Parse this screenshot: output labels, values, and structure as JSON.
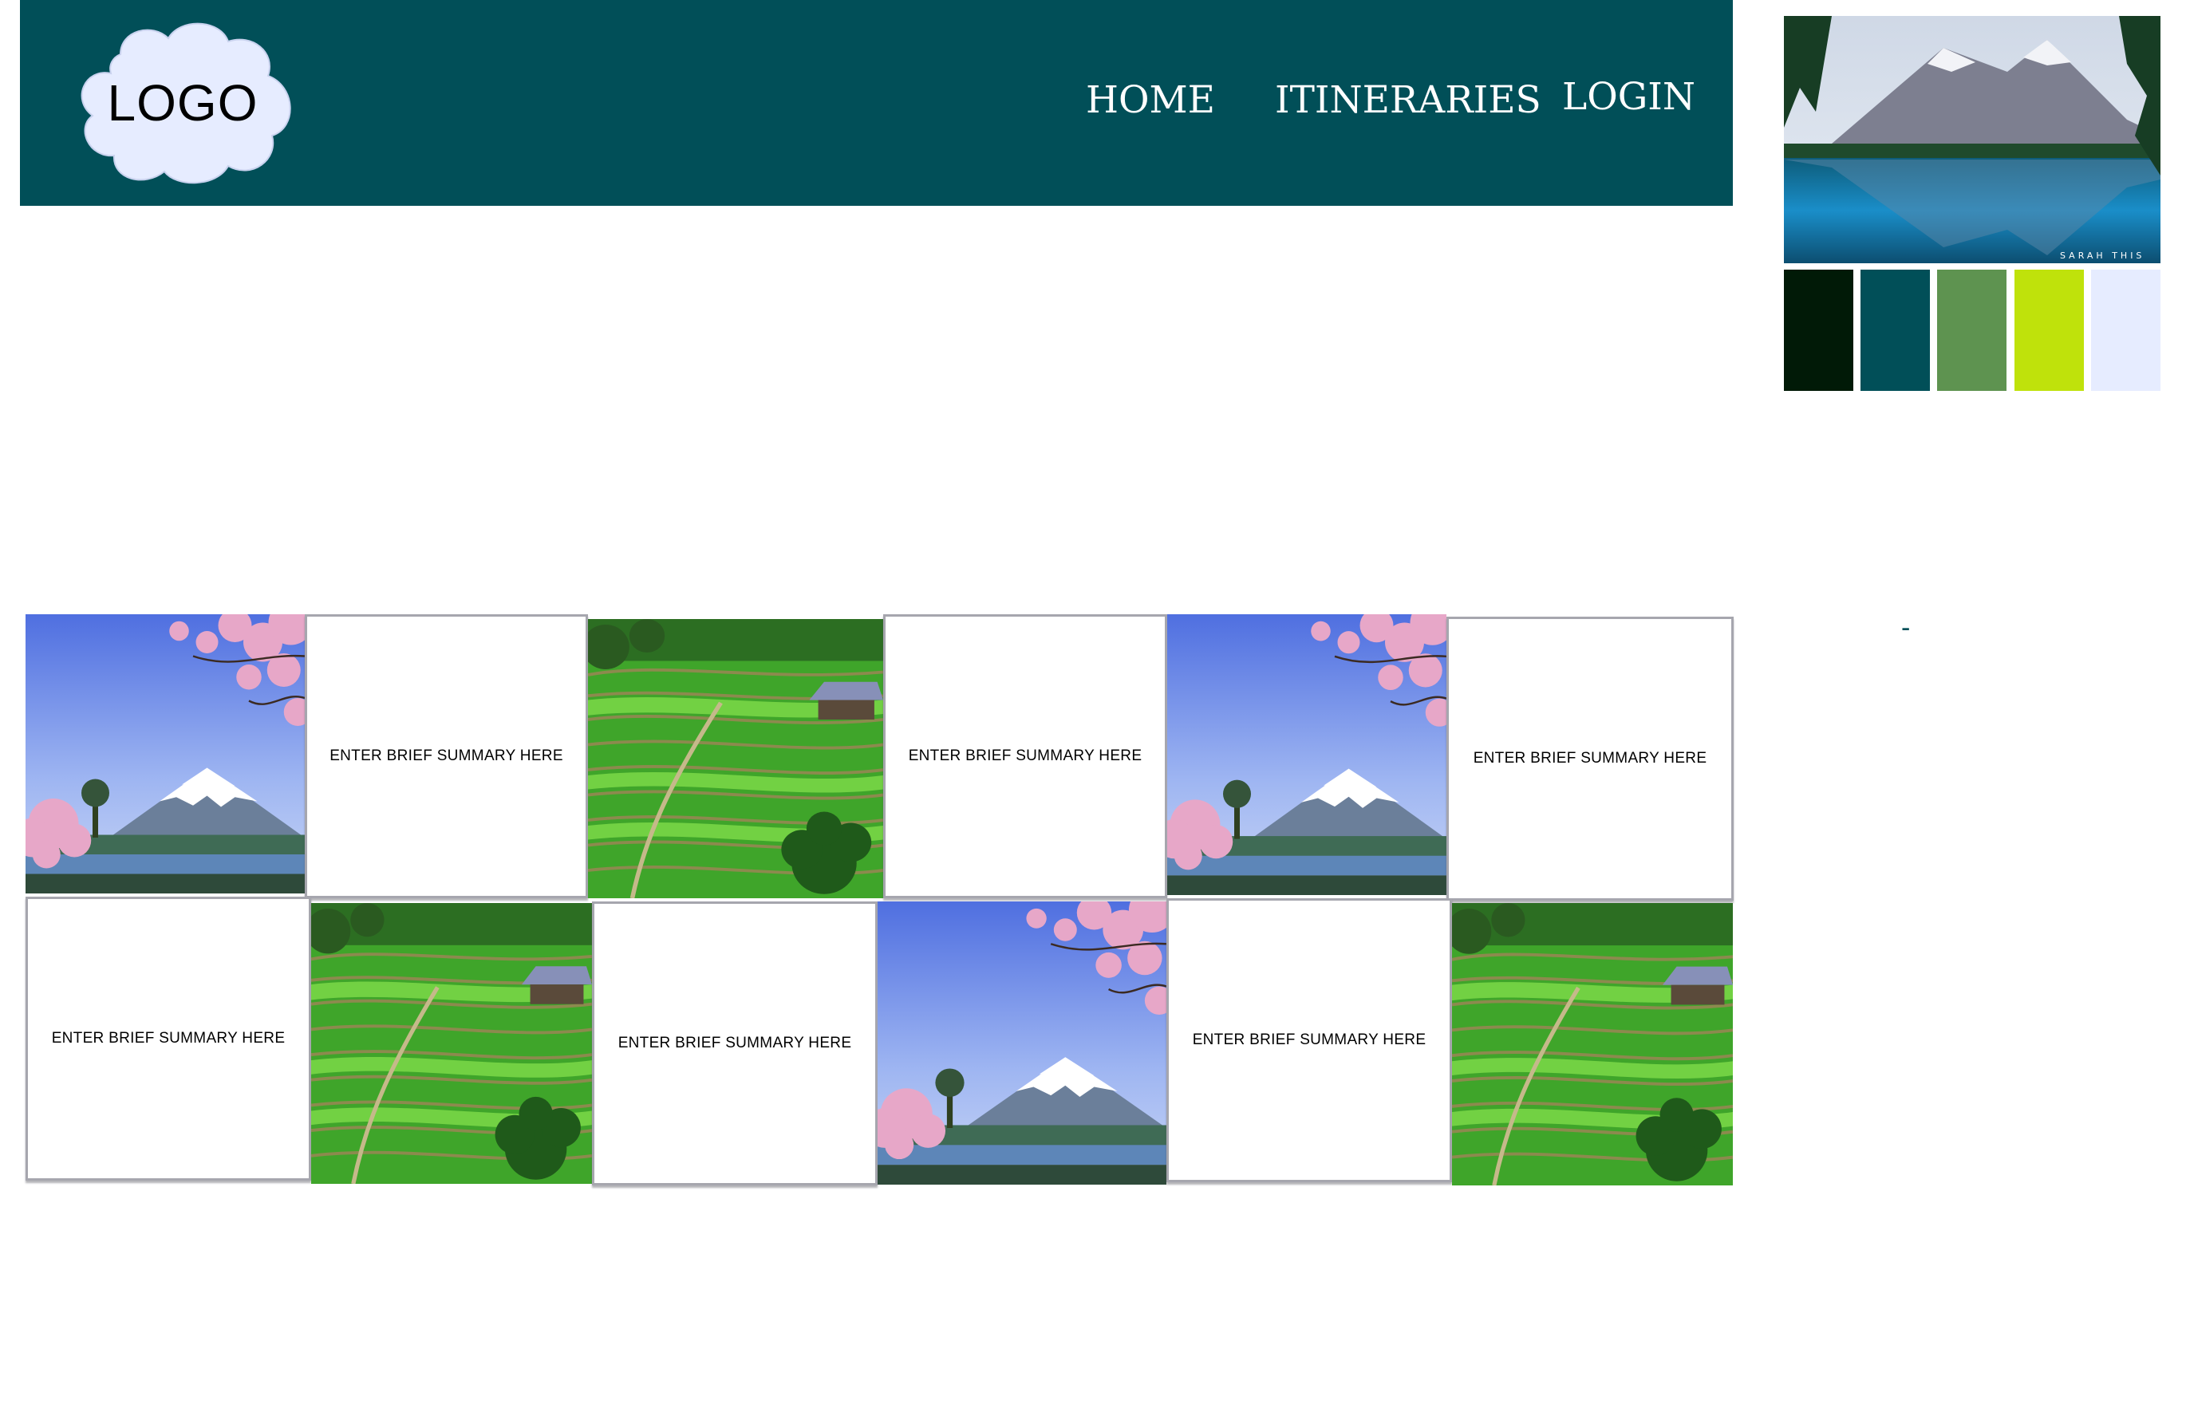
{
  "header": {
    "logo_text": "LOGO",
    "nav": {
      "home": "HOME",
      "itineraries": "ITINERARIES",
      "login": "LOGIN"
    },
    "background_color": "#014f58"
  },
  "palette": {
    "photo_watermark": "SARAH THIS",
    "swatches": [
      "#011a07",
      "#014f58",
      "#5e9350",
      "#bfe20b",
      "#e6ecff"
    ],
    "dash": "-"
  },
  "grid": {
    "summary_text": "ENTER BRIEF SUMMARY HERE",
    "images": {
      "cherry_fuji": "cherry-blossom-fuji-image",
      "rice_terrace": "rice-terrace-hut-image"
    }
  }
}
